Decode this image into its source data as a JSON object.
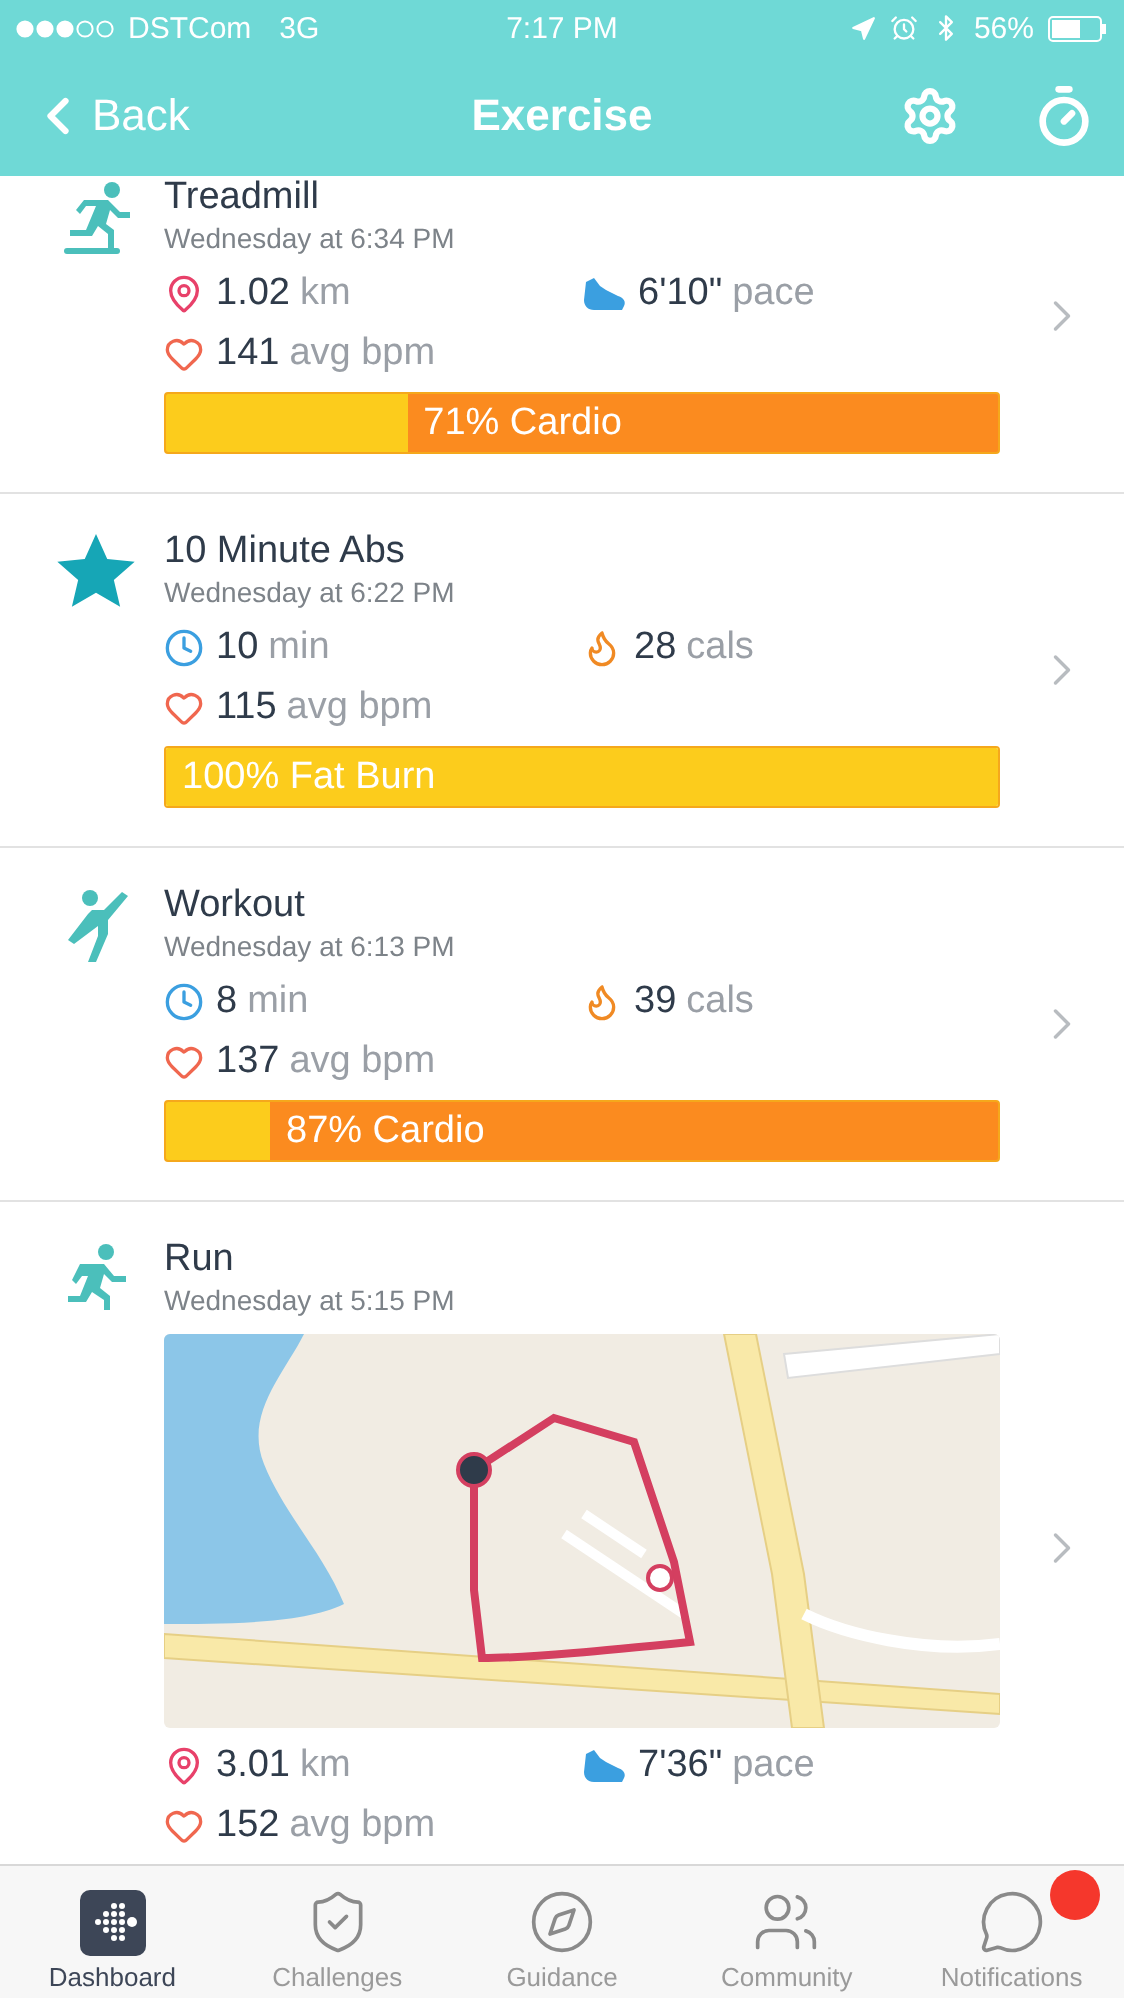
{
  "status_bar": {
    "carrier": "DSTCom",
    "network": "3G",
    "time": "7:17 PM",
    "battery": "56%"
  },
  "nav": {
    "back": "Back",
    "title": "Exercise"
  },
  "entries": [
    {
      "kind": "treadmill",
      "name": "Treadmill",
      "time": "Wednesday at 6:34 PM",
      "stats": [
        {
          "kind": "distance",
          "value": "1.02",
          "unit": "km"
        },
        {
          "kind": "pace",
          "value": "6'10\"",
          "unit": "pace"
        },
        {
          "kind": "heart",
          "value": "141",
          "unit": "avg bpm"
        }
      ],
      "zone": {
        "label": "71% Cardio",
        "level": 0.29
      }
    },
    {
      "kind": "star",
      "name": "10 Minute Abs",
      "time": "Wednesday at 6:22 PM",
      "stats": [
        {
          "kind": "duration",
          "value": "10",
          "unit": "min"
        },
        {
          "kind": "calories",
          "value": "28",
          "unit": "cals"
        },
        {
          "kind": "heart",
          "value": "115",
          "unit": "avg bpm"
        }
      ],
      "zone": {
        "label": "100% Fat Burn",
        "level": 1
      }
    },
    {
      "kind": "workout",
      "name": "Workout",
      "time": "Wednesday at 6:13 PM",
      "stats": [
        {
          "kind": "duration",
          "value": "8",
          "unit": "min"
        },
        {
          "kind": "calories",
          "value": "39",
          "unit": "cals"
        },
        {
          "kind": "heart",
          "value": "137",
          "unit": "avg bpm"
        }
      ],
      "zone": {
        "label": "87% Cardio",
        "level": 0.125
      }
    },
    {
      "kind": "run",
      "name": "Run",
      "time": "Wednesday at 5:15 PM",
      "map": {
        "kind": "picture"
      },
      "stats": [
        {
          "kind": "distance",
          "value": "3.01",
          "unit": "km"
        },
        {
          "kind": "pace",
          "value": "7'36\"",
          "unit": "pace"
        },
        {
          "kind": "heart",
          "value": "152",
          "unit": "avg bpm"
        }
      ]
    }
  ],
  "tabs": [
    {
      "kind": "dashboard",
      "label": "Dashboard",
      "selected": true,
      "badge": false
    },
    {
      "kind": "challenges",
      "label": "Challenges",
      "selected": false,
      "badge": false
    },
    {
      "kind": "guidance",
      "label": "Guidance",
      "selected": false,
      "badge": false
    },
    {
      "kind": "community",
      "label": "Community",
      "selected": false,
      "badge": false
    },
    {
      "kind": "notifications",
      "label": "Notifications",
      "selected": false,
      "badge": true
    }
  ]
}
